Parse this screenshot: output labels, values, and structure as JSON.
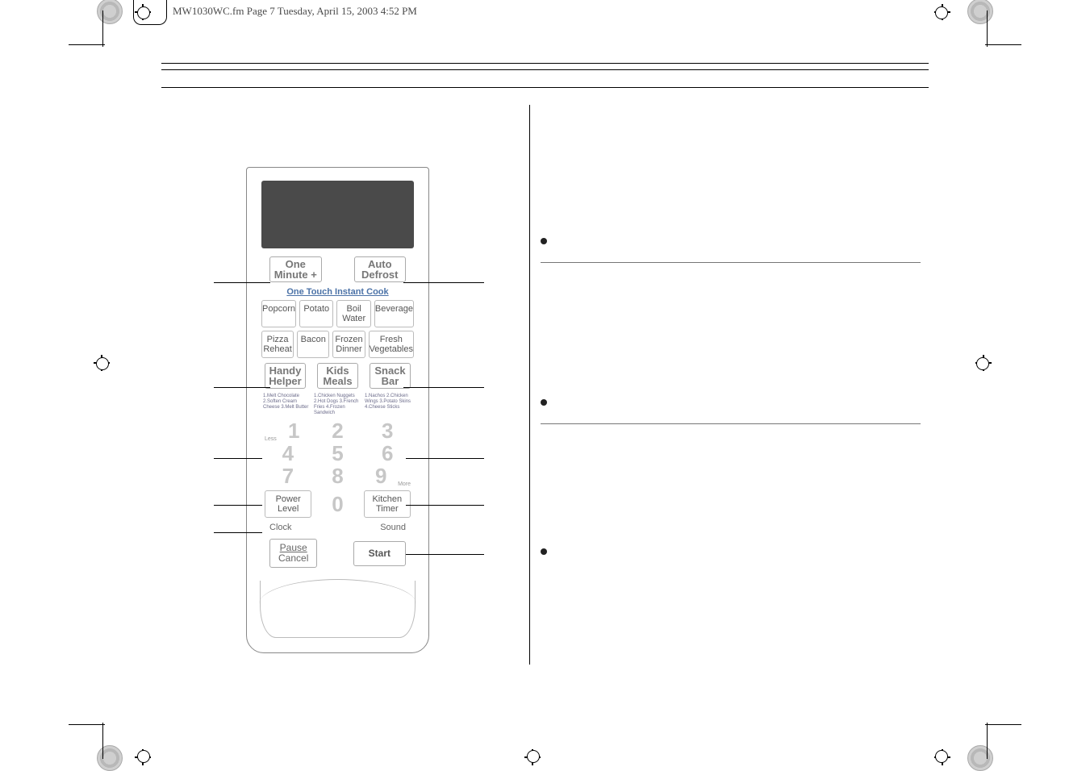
{
  "header": {
    "text": "MW1030WC.fm  Page 7  Tuesday, April 15, 2003  4:52 PM"
  },
  "panel": {
    "top_left": {
      "line1": "One",
      "line2": "Minute +"
    },
    "top_right": {
      "line1": "Auto",
      "line2": "Defrost"
    },
    "instant_label": "One Touch Instant Cook",
    "grid1": {
      "a": "Popcorn",
      "b": "Potato",
      "c": {
        "line1": "Boil",
        "line2": "Water"
      },
      "d": "Beverage"
    },
    "grid2": {
      "a": {
        "line1": "Pizza",
        "line2": "Reheat"
      },
      "b": "Bacon",
      "c": {
        "line1": "Frozen",
        "line2": "Dinner"
      },
      "d": {
        "line1": "Fresh",
        "line2": "Vegetables"
      }
    },
    "trio": {
      "a": {
        "line1": "Handy",
        "line2": "Helper"
      },
      "b": {
        "line1": "Kids",
        "line2": "Meals"
      },
      "c": {
        "line1": "Snack",
        "line2": "Bar"
      }
    },
    "micro": {
      "col1": "1.Melt Chocolate\n2.Soften Cream Cheese\n3.Melt Butter",
      "col2": "1.Chicken Nuggets\n2.Hot Dogs\n3.French Fries\n4.Frozen Sandwich",
      "col3": "1.Nachos\n2.Chicken Wings\n3.Potato Skins\n4.Cheese Sticks"
    },
    "nums": {
      "n1": "1",
      "n2": "2",
      "n3": "3",
      "n4": "4",
      "n5": "5",
      "n6": "6",
      "n7": "7",
      "n8": "8",
      "n9": "9",
      "n0": "0"
    },
    "less": "Less",
    "more": "More",
    "power": {
      "line1": "Power",
      "line2": "Level"
    },
    "kitchen": {
      "line1": "Kitchen",
      "line2": "Timer"
    },
    "clock": "Clock",
    "sound": "Sound",
    "pause": {
      "line1": "Pause",
      "line2": "Cancel"
    },
    "start": "Start"
  }
}
